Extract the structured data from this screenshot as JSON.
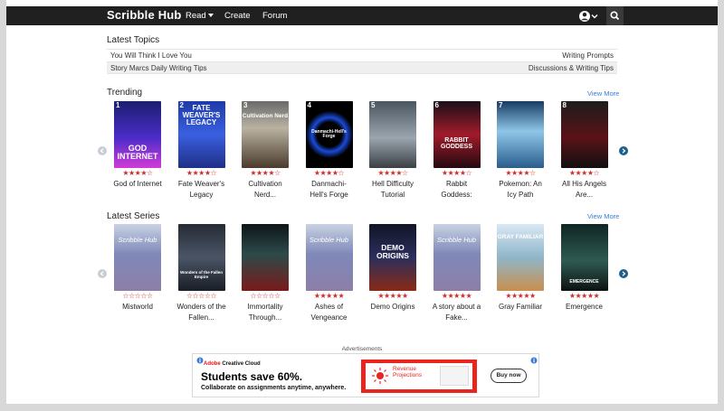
{
  "nav": {
    "brand": "Scribble Hub",
    "read": "Read",
    "create": "Create",
    "forum": "Forum",
    "icons": [
      "user-icon",
      "chevron-down-icon",
      "search-icon"
    ]
  },
  "latest_topics": {
    "title": "Latest Topics",
    "rows": [
      {
        "topic": "You Will Think I Love You",
        "category": "Writing Prompts"
      },
      {
        "topic": "Story Marcs Daily Writing Tips",
        "category": "Discussions & Writing Tips"
      }
    ]
  },
  "trending": {
    "title": "Trending",
    "view_more": "View More",
    "items": [
      {
        "rank": "1",
        "cover_text": "GOD INTERNET",
        "rating": 4,
        "title_line1": "God of Internet",
        "title_line2": ""
      },
      {
        "rank": "2",
        "cover_text": "FATE WEAVER'S LEGACY",
        "rating": 4,
        "title_line1": "Fate Weaver's",
        "title_line2": "Legacy"
      },
      {
        "rank": "3",
        "cover_text": "Cultivation Nerd",
        "rating": 4,
        "title_line1": "Cultivation",
        "title_line2": "Nerd..."
      },
      {
        "rank": "4",
        "cover_text": "Danmachi-Hell's Forge",
        "rating": 4,
        "title_line1": "Danmachi-",
        "title_line2": "Hell's Forge"
      },
      {
        "rank": "5",
        "cover_text": "",
        "rating": 4,
        "title_line1": "Hell Difficulty",
        "title_line2": "Tutorial"
      },
      {
        "rank": "6",
        "cover_text": "RABBIT GODDESS",
        "rating": 4,
        "title_line1": "Rabbit",
        "title_line2": "Goddess:"
      },
      {
        "rank": "7",
        "cover_text": "",
        "rating": 4,
        "title_line1": "Pokemon: An",
        "title_line2": "Icy Path"
      },
      {
        "rank": "8",
        "cover_text": "",
        "rating": 4,
        "title_line1": "All His Angels",
        "title_line2": "Are..."
      }
    ]
  },
  "latest_series": {
    "title": "Latest Series",
    "view_more": "View More",
    "items": [
      {
        "cover_text": "Scribble Hub",
        "rating": 0,
        "title_line1": "Mistworld",
        "title_line2": ""
      },
      {
        "cover_text": "Wonders of the Fallen Empire",
        "rating": 0,
        "title_line1": "Wonders of the",
        "title_line2": "Fallen..."
      },
      {
        "cover_text": "",
        "rating": 0,
        "title_line1": "Immortality",
        "title_line2": "Through..."
      },
      {
        "cover_text": "Scribble Hub",
        "rating": 5,
        "title_line1": "Ashes of",
        "title_line2": "Vengeance"
      },
      {
        "cover_text": "DEMO ORIGINS",
        "rating": 5,
        "title_line1": "Demo Origins",
        "title_line2": ""
      },
      {
        "cover_text": "Scribble Hub",
        "rating": 5,
        "title_line1": "A story about a",
        "title_line2": "Fake..."
      },
      {
        "cover_text": "GRAY FAMILIAR",
        "rating": 5,
        "title_line1": "Gray Familiar",
        "title_line2": ""
      },
      {
        "cover_text": "EMERGENCE",
        "rating": 5,
        "title_line1": "Emergence",
        "title_line2": ""
      }
    ]
  },
  "ads": {
    "label": "Advertisements",
    "brand_prefix": "Adobe",
    "brand_suffix": "Creative Cloud",
    "headline": "Students save 60%.",
    "subline": "Collaborate on assignments anytime, anywhere.",
    "box_title": "Revenue Projections",
    "cta": "Buy now"
  },
  "colors": {
    "nav_bg": "#202020",
    "link": "#3a7bd5",
    "star": "#c9302c",
    "arrow_active": "#1f5f8e",
    "ad_red": "#e8261f"
  }
}
